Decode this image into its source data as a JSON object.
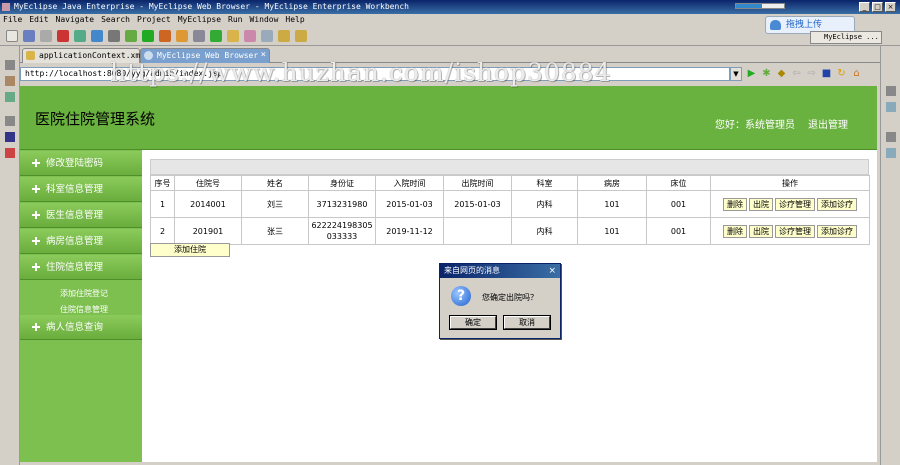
{
  "window": {
    "title": "MyEclipse Java Enterprise - MyEclipse Web Browser - MyEclipse Enterprise Workbench",
    "progress": 0.55
  },
  "menu": [
    "File",
    "Edit",
    "Navigate",
    "Search",
    "Project",
    "MyEclipse",
    "Run",
    "Window",
    "Help"
  ],
  "upload_button": "拖拽上传",
  "perspective_label": "MyEclipse ...",
  "tabs": [
    {
      "label": "applicationContext.xml",
      "active": false
    },
    {
      "label": "MyEclipse Web Browser",
      "active": true
    }
  ],
  "browser": {
    "url": "http://localhost:8080/yyg/admin/index.jsp"
  },
  "watermark": "https://www.huzhan.com/ishop30884",
  "app": {
    "title": "医院住院管理系统",
    "greeting": "您好：系统管理员",
    "logout": "退出管理"
  },
  "sidebar": {
    "items": [
      {
        "label": "修改登陆密码"
      },
      {
        "label": "科室信息管理"
      },
      {
        "label": "医生信息管理"
      },
      {
        "label": "病房信息管理"
      },
      {
        "label": "住院信息管理"
      },
      {
        "label": "病人信息查询"
      }
    ],
    "subitems": [
      {
        "label": "添加住院登记"
      },
      {
        "label": "住院信息管理"
      }
    ]
  },
  "table": {
    "columns": [
      "序号",
      "住院号",
      "姓名",
      "身份证",
      "入院时间",
      "出院时间",
      "科室",
      "病房",
      "床位",
      "操作"
    ],
    "rows": [
      {
        "index": "1",
        "admission_no": "2014001",
        "name": "刘三",
        "id_card": "3713231980",
        "admit_date": "2015-01-03",
        "discharge_date": "2015-01-03",
        "department": "内科",
        "ward": "101",
        "bed": "001"
      },
      {
        "index": "2",
        "admission_no": "201901",
        "name": "张三",
        "id_card": "622224198305033333",
        "admit_date": "2019-11-12",
        "discharge_date": "",
        "department": "内科",
        "ward": "101",
        "bed": "001"
      }
    ],
    "actions": [
      "删除",
      "出院",
      "诊疗管理",
      "添加诊疗"
    ]
  },
  "add_button": "添加住院",
  "dialog": {
    "title": "来自网页的消息",
    "message": "您确定出院吗？",
    "ok": "确定",
    "cancel": "取消"
  }
}
